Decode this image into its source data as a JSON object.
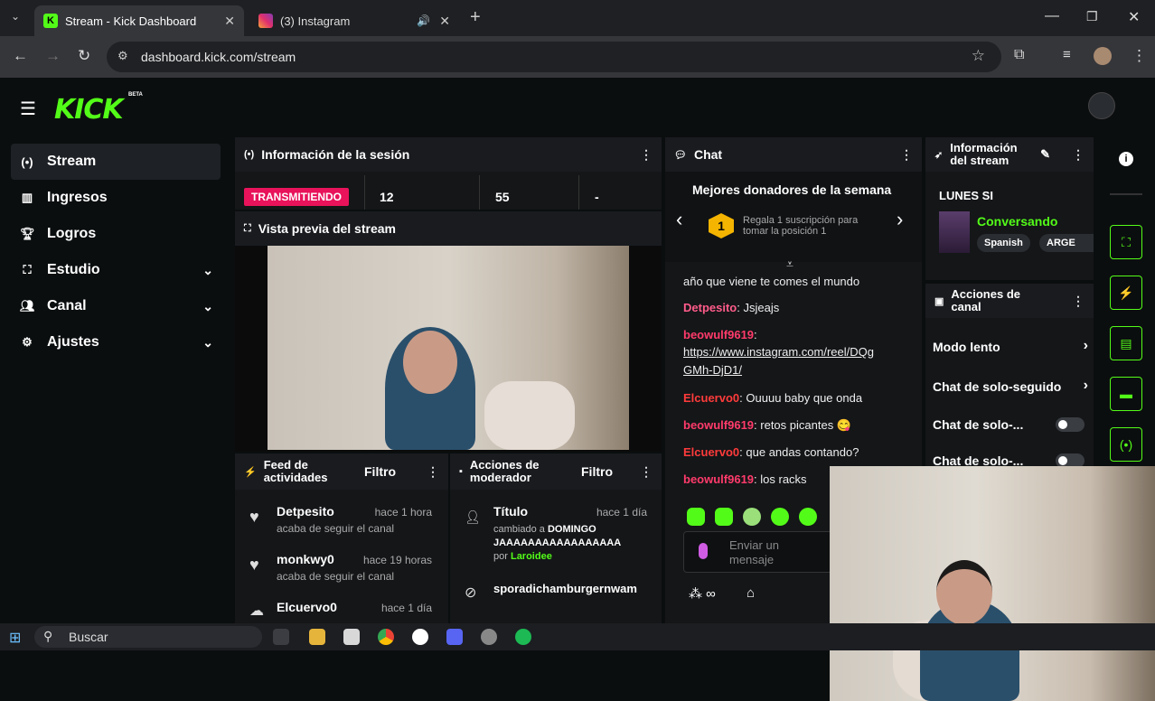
{
  "browser": {
    "tabs": [
      {
        "title": "Stream - Kick Dashboard",
        "favicon": "K"
      },
      {
        "title": "(3) Instagram"
      }
    ],
    "url": "dashboard.kick.com/stream"
  },
  "app": {
    "logo": "KICK",
    "logo_badge": "BETA",
    "sidebar": [
      {
        "label": "Stream",
        "icon": "broadcast-icon",
        "active": true
      },
      {
        "label": "Ingresos",
        "icon": "chart-icon"
      },
      {
        "label": "Logros",
        "icon": "trophy-icon"
      },
      {
        "label": "Estudio",
        "icon": "studio-icon",
        "expandable": true
      },
      {
        "label": "Canal",
        "icon": "users-icon",
        "expandable": true
      },
      {
        "label": "Ajustes",
        "icon": "gear-icon",
        "expandable": true
      }
    ],
    "session": {
      "title": "Información de la sesión",
      "status": "TRANSMITIENDO",
      "stat1": "12",
      "stat2": "55",
      "stat3": "-"
    },
    "preview": {
      "title": "Vista previa del stream"
    },
    "activity": {
      "title_line1": "Feed de",
      "title_line2": "actividades",
      "filter": "Filtro",
      "items": [
        {
          "user": "Detpesito",
          "time": "hace 1 hora",
          "action": "acaba de seguir el canal"
        },
        {
          "user": "monkwy0",
          "time": "hace 19 horas",
          "action": "acaba de seguir el canal"
        },
        {
          "user": "Elcuervo0",
          "time": "hace 1 día"
        }
      ]
    },
    "modactions": {
      "title_line1": "Acciones de",
      "title_line2": "moderador",
      "filter": "Filtro",
      "item1_title": "Título",
      "item1_time": "hace 1 día",
      "item1_changed": "cambiado a",
      "item1_value": "DOMINGO JAAAAAAAAAAAAAAAAA",
      "item1_by": "por",
      "item1_mod": "Laroidee",
      "item2_user": "sporadichamburgernwam"
    },
    "chat": {
      "title": "Chat",
      "donors_title": "Mejores donadores de la semana",
      "donor_rank": "1",
      "donor_text_line1": "Regala 1 suscripción para",
      "donor_text_line2": "tomar la posición 1",
      "messages": [
        {
          "user": "",
          "text": "año que viene te comes el mundo"
        },
        {
          "user": "Detpesito",
          "text": "Jsjeajs",
          "color": "#ff5c8a"
        },
        {
          "user": "beowulf9619",
          "text": "",
          "color": "#ff3b6b"
        },
        {
          "user": "",
          "text": "https://www.instagram.com/reel/DQg"
        },
        {
          "user": "",
          "text": "GMh-DjD1/"
        },
        {
          "user": "Elcuervo0",
          "text": "Ouuuu baby que onda",
          "color": "#ff3b3b"
        },
        {
          "user": "beowulf9619",
          "text": "retos picantes 😋",
          "color": "#ff3b6b"
        },
        {
          "user": "Elcuervo0",
          "text": "que andas contando?",
          "color": "#ff3b3b"
        },
        {
          "user": "beowulf9619",
          "text": "los racks",
          "color": "#ff3b6b"
        }
      ],
      "input_placeholder": "Enviar un mensaje"
    },
    "stream_info": {
      "title_line1": "Información",
      "title_line2": "del stream",
      "stream_title": "LUNES SI",
      "category": "Conversando",
      "tags": [
        "Spanish",
        "ARGE"
      ]
    },
    "channel_actions": {
      "title_line1": "Acciones de",
      "title_line2": "canal",
      "items": [
        {
          "label": "Modo lento",
          "type": "link"
        },
        {
          "label": "Chat de solo-seguido",
          "type": "link"
        },
        {
          "label": "Chat de solo-...",
          "type": "toggle"
        },
        {
          "label": "Chat de solo-...",
          "type": "toggle"
        }
      ]
    }
  },
  "taskbar": {
    "search": "Buscar"
  },
  "colors": {
    "accent": "#53fc18",
    "live": "#e8135a",
    "bg": "#0b0e0f",
    "panel": "#141618"
  }
}
